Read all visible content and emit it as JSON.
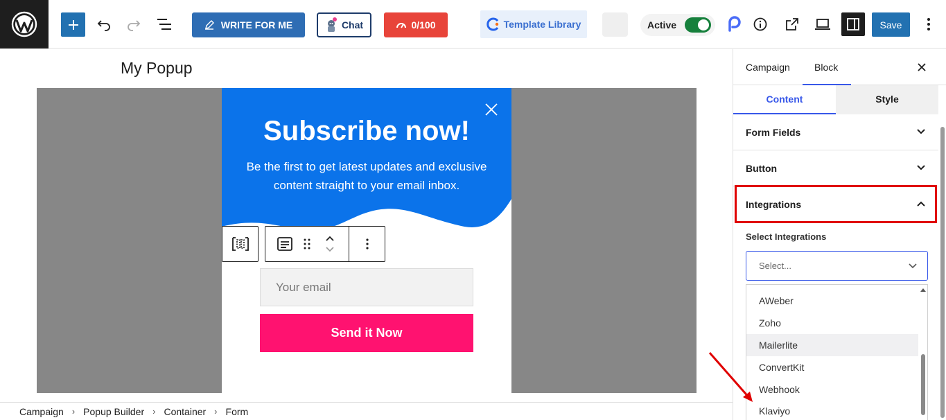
{
  "toolbar": {
    "write_label": "WRITE FOR ME",
    "chat_label": "Chat",
    "score_label": "0/100",
    "template_label": "Template Library",
    "active_label": "Active",
    "save_label": "Save"
  },
  "editor": {
    "title": "My Popup"
  },
  "popup": {
    "heading": "Subscribe now!",
    "subheading": "Be the first to get latest updates and exclusive content straight to your email inbox.",
    "email_placeholder": "Your email",
    "button_label": "Send it Now",
    "colors": {
      "blue": "#0b73ea",
      "button": "#ff1270"
    }
  },
  "breadcrumb": [
    "Campaign",
    "Popup Builder",
    "Container",
    "Form"
  ],
  "sidebar": {
    "tabs": [
      "Campaign",
      "Block"
    ],
    "sub_tabs": [
      "Content",
      "Style"
    ],
    "sections": [
      "Form Fields",
      "Button",
      "Integrations"
    ],
    "select_label": "Select Integrations",
    "select_placeholder": "Select...",
    "options": [
      "AWeber",
      "Zoho",
      "Mailerlite",
      "ConvertKit",
      "Webhook",
      "Klaviyo"
    ],
    "hovered_option": "Mailerlite"
  },
  "icons": {
    "logo": "wordpress-icon",
    "add": "plus-icon",
    "undo": "undo-icon",
    "redo": "redo-icon",
    "list_view": "list-view-icon",
    "info": "info-icon",
    "external": "external-link-icon",
    "preview": "desktop-preview-icon",
    "panel": "settings-panel-icon"
  }
}
